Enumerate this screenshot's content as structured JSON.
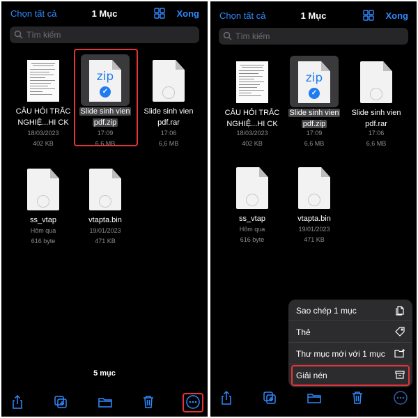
{
  "header": {
    "select_all": "Chọn tất cả",
    "title": "1 Mục",
    "done": "Xong"
  },
  "search": {
    "placeholder": "Tìm kiếm"
  },
  "files": [
    {
      "name_line1": "CÂU HỎI TRẮC",
      "name_line2": "NGHIỆ...HI CK",
      "date": "18/03/2023",
      "size": "402 KB",
      "icon": "pdf-document-thumbnail"
    },
    {
      "name_line1": "Slide sinh vien",
      "name_line2": "pdf.zip",
      "date": "17:09",
      "size": "6,6 MB",
      "icon": "zip-icon",
      "zip_text": "zip",
      "selected": true
    },
    {
      "name_line1": "Slide sinh vien",
      "name_line2": "pdf.rar",
      "date": "17:06",
      "size": "6,6 MB",
      "icon": "generic-file-icon"
    },
    {
      "name_line1": "ss_vtap",
      "name_line2": "",
      "date": "Hôm qua",
      "size": "616 byte",
      "icon": "generic-file-icon"
    },
    {
      "name_line1": "vtapta.bin",
      "name_line2": "",
      "date": "19/01/2023",
      "size": "471 KB",
      "icon": "generic-file-icon"
    }
  ],
  "footer": {
    "items_count": "5 mục"
  },
  "toolbar": [
    "share-icon",
    "duplicate-icon",
    "folder-icon",
    "trash-icon",
    "more-icon"
  ],
  "context_menu": [
    {
      "label": "Sao chép 1 mục",
      "icon": "copy-doc-icon"
    },
    {
      "label": "Thẻ",
      "icon": "tag-icon"
    },
    {
      "label": "Thư mục mới với 1 mục",
      "icon": "new-folder-icon"
    },
    {
      "label": "Giải nén",
      "icon": "archive-box-icon"
    }
  ],
  "colors": {
    "accent": "#2f8bff",
    "background": "#000000",
    "highlight": "#e8333a",
    "menu_bg": "#2c2c2e"
  }
}
